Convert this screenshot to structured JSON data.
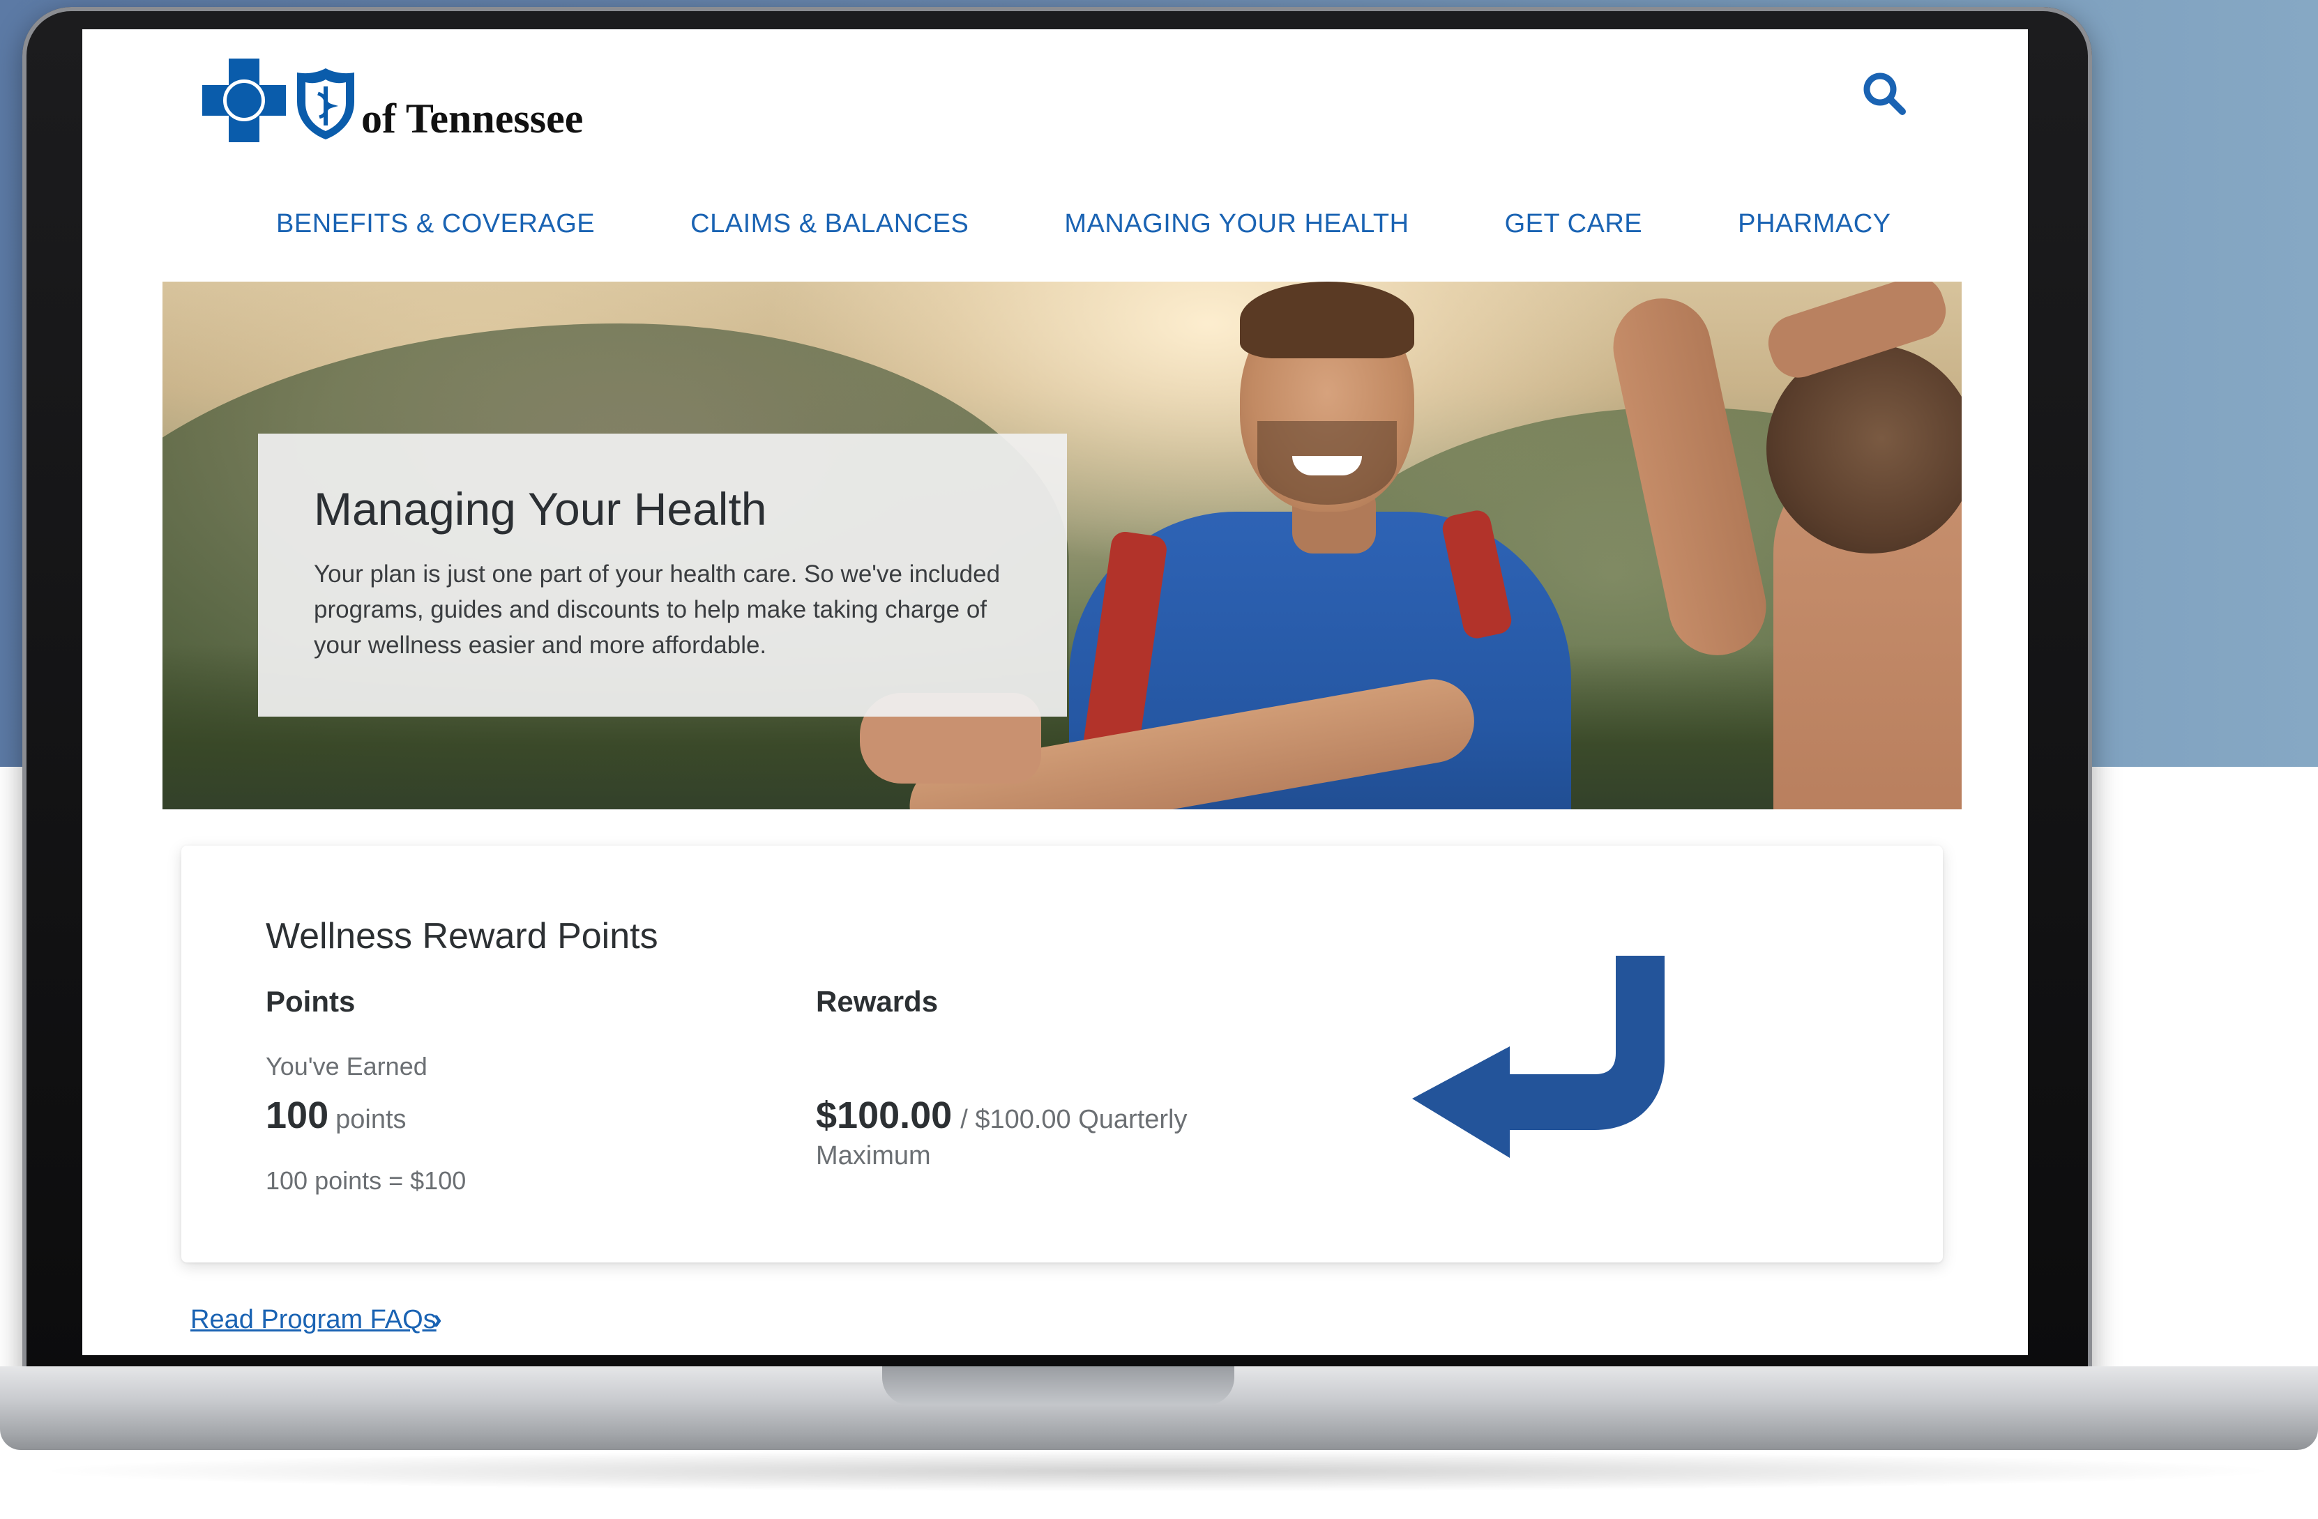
{
  "header": {
    "logo_text": "of Tennessee"
  },
  "nav": {
    "items": [
      {
        "label": "BENEFITS & COVERAGE"
      },
      {
        "label": "CLAIMS & BALANCES"
      },
      {
        "label": "MANAGING YOUR HEALTH"
      },
      {
        "label": "GET CARE"
      },
      {
        "label": "PHARMACY"
      }
    ]
  },
  "hero": {
    "title": "Managing Your Health",
    "description": "Your plan is just one part of your health care. So we've included programs, guides and discounts to help make taking charge of your wellness easier and more affordable."
  },
  "rewards_card": {
    "title": "Wellness Reward Points",
    "points_heading": "Points",
    "rewards_heading": "Rewards",
    "earned_label": "You've Earned",
    "points_value": "100",
    "points_unit": "points",
    "conversion": "100 points = $100",
    "reward_amount": "$100.00",
    "reward_max": "/ $100.00 Quarterly",
    "reward_max_word": "Maximum"
  },
  "links": {
    "faq": "Read Program FAQs",
    "faq_chevron": "›"
  },
  "colors": {
    "brand_blue": "#0a5cab",
    "link_blue": "#1a63b3",
    "arrow_blue": "#23549a",
    "background_blue": "#6a88ae"
  },
  "icons": {
    "search": "search-icon",
    "arrow": "curved-arrow-icon",
    "logo_cross": "blue-cross-icon",
    "logo_shield": "blue-shield-icon"
  }
}
